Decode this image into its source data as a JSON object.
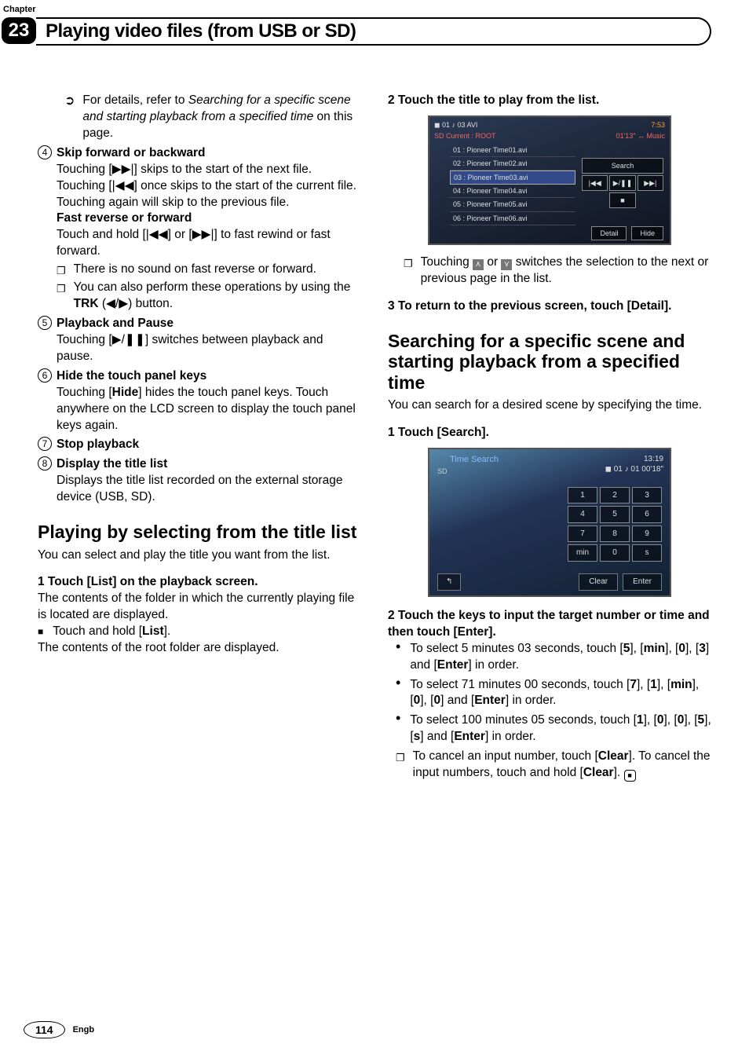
{
  "chapter_label": "Chapter",
  "chapter_number": "23",
  "header_title": "Playing video files (from USB or SD)",
  "left": {
    "ref_prefix": "For details, refer to ",
    "ref_italic": "Searching for a specific scene and starting playback from a specified time",
    "ref_suffix": " on this page.",
    "item4_title": "Skip forward or backward",
    "item4_body": "Touching [▶▶|] skips to the start of the next file. Touching [|◀◀] once skips to the start of the current file. Touching again will skip to the previous file.",
    "item4_sub_title": "Fast reverse or forward",
    "item4_sub_body": "Touch and hold [|◀◀] or [▶▶|] to fast rewind or fast forward.",
    "item4_note1": "There is no sound on fast reverse or forward.",
    "item4_note2_pre": "You can also perform these operations by using the ",
    "item4_note2_bold": "TRK",
    "item4_note2_post": " (◀/▶) button.",
    "item5_title": "Playback and Pause",
    "item5_body": "Touching [▶/❚❚] switches between playback and pause.",
    "item6_title": "Hide the touch panel keys",
    "item6_body_pre": "Touching [",
    "item6_body_bold": "Hide",
    "item6_body_post": "] hides the touch panel keys. Touch anywhere on the LCD screen to display the touch panel keys again.",
    "item7_title": "Stop playback",
    "item8_title": "Display the title list",
    "item8_body": "Displays the title list recorded on the external storage device (USB, SD).",
    "section1": "Playing by selecting from the title list",
    "section1_intro": "You can select and play the title you want from the list.",
    "step1_label": "1    Touch [List] on the playback screen.",
    "step1_body": "The contents of the folder in which the currently playing file is located are displayed.",
    "step1_bullet_pre": "Touch and hold [",
    "step1_bullet_bold": "List",
    "step1_bullet_post": "].",
    "step1_after": "The contents of the root folder are displayed."
  },
  "right": {
    "step2_label": "2    Touch the title to play from the list.",
    "thumb1": {
      "top_icons": "◼ 01   ♪ 03    AVI",
      "top_right": "7:53",
      "line2_left": "SD  Current : ROOT",
      "line2_right": "01'13\"  ↔ Music",
      "rows": [
        "01  : Pioneer Time01.avi",
        "02  : Pioneer Time02.avi",
        "03  : Pioneer Time03.avi",
        "04  : Pioneer Time04.avi",
        "05  : Pioneer Time05.avi",
        "06  : Pioneer Time06.avi"
      ],
      "search": "Search",
      "prev": "|◀◀",
      "play": "▶/❚❚",
      "next": "▶▶|",
      "stop": "■",
      "detail": "Detail",
      "hide": "Hide"
    },
    "step2_note_pre": "Touching ",
    "step2_note_mid": " or ",
    "step2_note_post": " switches the selection to the next or previous page in the list.",
    "step3_label": "3    To return to the previous screen, touch [Detail].",
    "section2": "Searching for a specific scene and starting playback from a specified time",
    "section2_intro": "You can search for a desired scene by specifying the time.",
    "s2_step1": "1    Touch [Search].",
    "thumb2": {
      "title": "Time Search",
      "time_r1": "13:19",
      "hdr2_line": "◼ 01    ♪ 01    00'18\"",
      "keys_r1": [
        "1",
        "2",
        "3"
      ],
      "keys_r2": [
        "4",
        "5",
        "6"
      ],
      "keys_r3": [
        "7",
        "8",
        "9"
      ],
      "keys_r4": [
        "min",
        "0",
        "s"
      ],
      "clear": "Clear",
      "enter": "Enter",
      "back": "↰",
      "sd": "SD"
    },
    "s2_step2": "2    Touch the keys to input the target number or time and then touch [Enter].",
    "b1_pre": "To select 5 minutes 03 seconds, touch [",
    "b1_parts": [
      "5",
      "min",
      "0",
      "3",
      "Enter"
    ],
    "b1_post": "] in order.",
    "b2_pre": "To select 71 minutes 00 seconds, touch [",
    "b2_parts": [
      "7",
      "1",
      "min",
      "0",
      "0",
      "Enter"
    ],
    "b2_post": "] in order.",
    "b3_pre": "To select 100 minutes 05 seconds, touch [",
    "b3_parts": [
      "1",
      "0",
      "0",
      "5",
      "s",
      "Enter"
    ],
    "b3_post": "] in order.",
    "note_pre": "To cancel an input number, touch [",
    "note_bold1": "Clear",
    "note_mid": "]. To cancel the input numbers, touch and hold [",
    "note_bold2": "Clear",
    "note_post": "]."
  },
  "page_number": "114",
  "region": "Engb"
}
